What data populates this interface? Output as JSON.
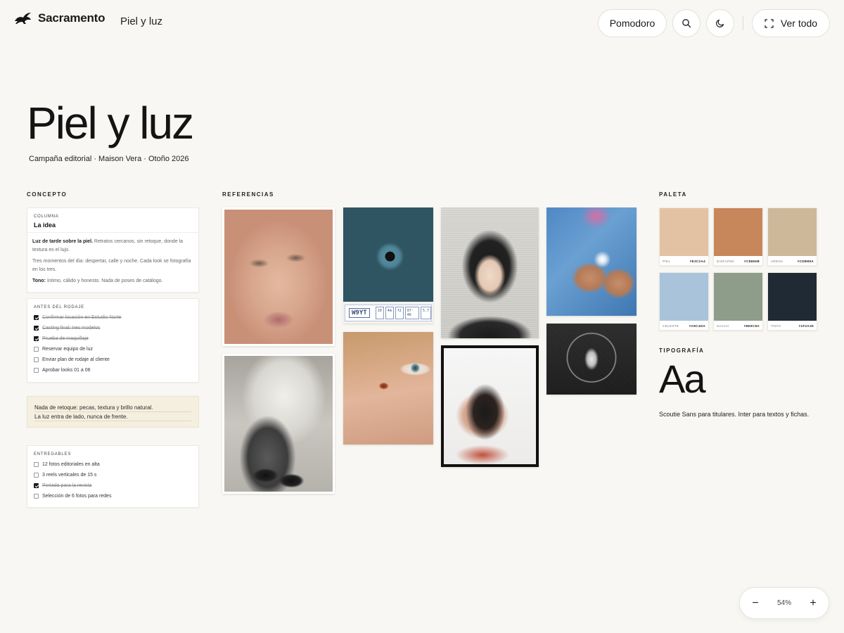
{
  "app": {
    "brand_name": "Sacramento",
    "breadcrumb": "Piel y luz"
  },
  "toolbar": {
    "pomodoro_label": "Pomodoro",
    "view_all_label": "Ver todo",
    "icons": [
      "search-icon",
      "moon-icon",
      "expand-icon"
    ]
  },
  "header": {
    "title": "Piel y luz",
    "subtitle": "Campaña editorial · Maison Vera · Otoño 2026"
  },
  "sections": {
    "concept": "CONCEPTO",
    "references": "REFERENCIAS",
    "palette": "PALETA",
    "typography": "TIPOGRAFÍA"
  },
  "idea_card": {
    "kicker": "COLUMNA",
    "title": "La idea",
    "p1_bold": "Luz de tarde sobre la piel.",
    "p1_rest": " Retratos cercanos, sin retoque, donde la textura es el lujo.",
    "p2": "Tres momentos del día: despertar, calle y noche. Cada look se fotografía en los tres.",
    "p3_bold": "Tono:",
    "p3_rest": " íntimo, cálido y honesto. Nada de poses de catálogo."
  },
  "checklist": {
    "title": "ANTES DEL RODAJE",
    "items": [
      {
        "label": "Confirmar locación en Estudio Norte",
        "done": true
      },
      {
        "label": "Casting final: tres modelos",
        "done": true
      },
      {
        "label": "Prueba de maquillaje",
        "done": true
      },
      {
        "label": "Reservar equipo de luz",
        "done": false
      },
      {
        "label": "Enviar plan de rodaje al cliente",
        "done": false
      },
      {
        "label": "Aprobar looks 01 a 06",
        "done": false
      }
    ]
  },
  "note": {
    "line1": "Nada de retoque: pecas, textura y brillo natural.",
    "line2": "La luz entra de lado, nunca de frente."
  },
  "deliverables": {
    "title": "ENTREGABLES",
    "items": [
      {
        "label": "12 fotos editoriales en alta",
        "done": false
      },
      {
        "label": "3 reels verticales de 15 s",
        "done": false
      },
      {
        "label": "Portada para la revista",
        "done": true
      },
      {
        "label": "Selección de 6 fotos para redes",
        "done": false
      }
    ]
  },
  "references": {
    "ticket_code": "W9YT",
    "ticket_cells": [
      "10",
      "4m",
      "f2",
      "07-46",
      "5.7"
    ]
  },
  "palette": [
    {
      "name": "PIEL",
      "hex": "#E3C2A4"
    },
    {
      "name": "DURAZNO",
      "hex": "#C8865B"
    },
    {
      "name": "ARENA",
      "hex": "#CDB89A"
    },
    {
      "name": "CELESTE",
      "hex": "#A9C4DA"
    },
    {
      "name": "SALVIA",
      "hex": "#8E9C8A"
    },
    {
      "name": "TINTA",
      "hex": "#1F2A35"
    }
  ],
  "typography": {
    "sample": "Aa",
    "caption": "Scoutie Sans para titulares. Inter para textos y fichas."
  },
  "zoom": {
    "level": "54%",
    "minus": "−",
    "plus": "+"
  }
}
